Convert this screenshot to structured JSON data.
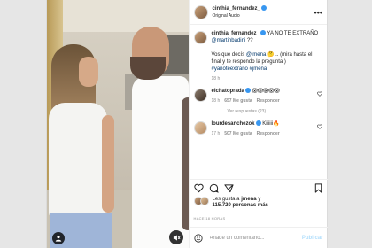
{
  "header": {
    "username": "cinthia_fernandez_",
    "subtitle": "Original Audio",
    "more": "•••"
  },
  "caption": {
    "username": "cinthia_fernandez_",
    "line1": "YA NO TE EXTRAÑO",
    "mention1": "@martinbadini",
    "line1_end": "??",
    "line2_start": "Vos que decís",
    "mention2": "@jmena",
    "emoji": "🤔",
    "line2_end": "... (mira hasta el final y te respondo la pregunta )",
    "hashtags": "#yanoteextraño #jmena",
    "time": "18 h"
  },
  "comments": [
    {
      "username": "elchatoprada",
      "verified": true,
      "text": "😱😱😱😱😱",
      "time": "18 h",
      "likes": "657 Me gusta",
      "reply": "Responder",
      "replies": "Ver respuestas (23)"
    },
    {
      "username": "lourdesanchezok",
      "verified": true,
      "text": "Kiiiiii🔥",
      "time": "17 h",
      "likes": "507 Me gusta",
      "reply": "Responder"
    }
  ],
  "likes": {
    "prefix": "Les gusta a",
    "user": "jmena",
    "suffix": "y",
    "count": "115.720 personas más"
  },
  "timestamp": "HACE 18 HORAS",
  "add_comment": {
    "placeholder": "Añade un comentario...",
    "publish": "Publicar"
  },
  "colors": {
    "verified": "#3897f0",
    "link": "#00376b",
    "publish_disabled": "#b2dffc"
  }
}
